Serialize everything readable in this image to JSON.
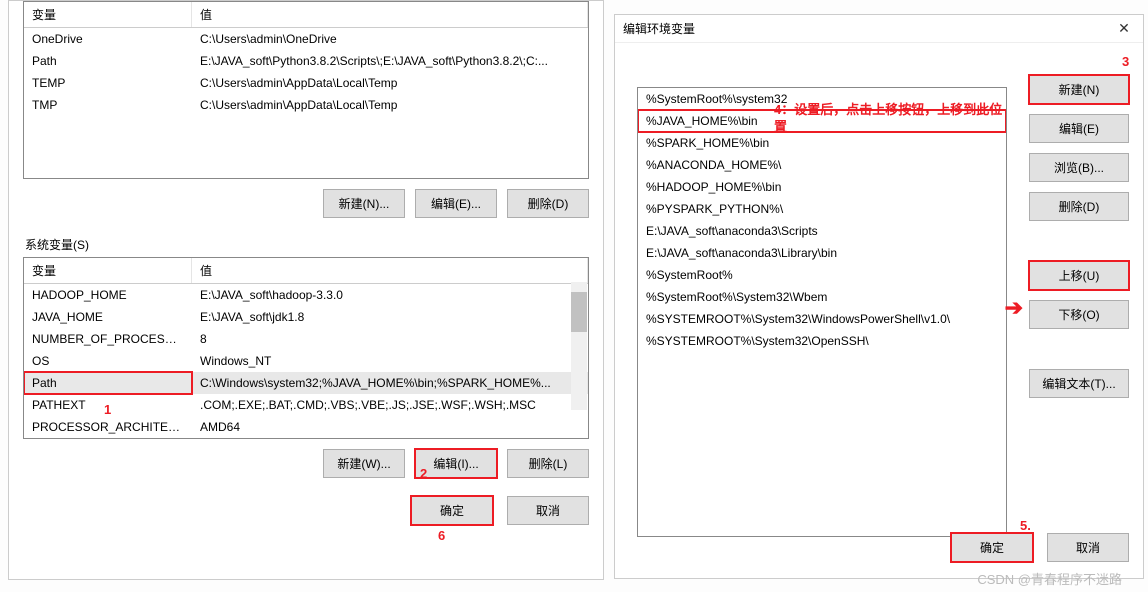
{
  "dialog1": {
    "userVars": {
      "header": {
        "var": "变量",
        "val": "值"
      },
      "rows": [
        {
          "name": "OneDrive",
          "value": "C:\\Users\\admin\\OneDrive"
        },
        {
          "name": "Path",
          "value": "E:\\JAVA_soft\\Python3.8.2\\Scripts\\;E:\\JAVA_soft\\Python3.8.2\\;C:..."
        },
        {
          "name": "TEMP",
          "value": "C:\\Users\\admin\\AppData\\Local\\Temp"
        },
        {
          "name": "TMP",
          "value": "C:\\Users\\admin\\AppData\\Local\\Temp"
        }
      ],
      "buttons": {
        "new": "新建(N)...",
        "edit": "编辑(E)...",
        "delete": "删除(D)"
      }
    },
    "sysLabel": "系统变量(S)",
    "sysVars": {
      "header": {
        "var": "变量",
        "val": "值"
      },
      "rows": [
        {
          "name": "HADOOP_HOME",
          "value": "E:\\JAVA_soft\\hadoop-3.3.0"
        },
        {
          "name": "JAVA_HOME",
          "value": "E:\\JAVA_soft\\jdk1.8"
        },
        {
          "name": "NUMBER_OF_PROCESSORS",
          "value": "8"
        },
        {
          "name": "OS",
          "value": "Windows_NT"
        },
        {
          "name": "Path",
          "value": "C:\\Windows\\system32;%JAVA_HOME%\\bin;%SPARK_HOME%..."
        },
        {
          "name": "PATHEXT",
          "value": ".COM;.EXE;.BAT;.CMD;.VBS;.VBE;.JS;.JSE;.WSF;.WSH;.MSC"
        },
        {
          "name": "PROCESSOR_ARCHITECT...",
          "value": "AMD64"
        }
      ],
      "buttons": {
        "new": "新建(W)...",
        "edit": "编辑(I)...",
        "delete": "删除(L)"
      }
    },
    "footer": {
      "ok": "确定",
      "cancel": "取消"
    }
  },
  "dialog2": {
    "title": "编辑环境变量",
    "pathItems": [
      "%SystemRoot%\\system32",
      "%JAVA_HOME%\\bin",
      "%SPARK_HOME%\\bin",
      "%ANACONDA_HOME%\\",
      "%HADOOP_HOME%\\bin",
      "%PYSPARK_PYTHON%\\",
      "E:\\JAVA_soft\\anaconda3\\Scripts",
      "E:\\JAVA_soft\\anaconda3\\Library\\bin",
      "%SystemRoot%",
      "%SystemRoot%\\System32\\Wbem",
      "%SYSTEMROOT%\\System32\\WindowsPowerShell\\v1.0\\",
      "%SYSTEMROOT%\\System32\\OpenSSH\\"
    ],
    "sideButtons": {
      "new": "新建(N)",
      "edit": "编辑(E)",
      "browse": "浏览(B)...",
      "delete": "删除(D)",
      "moveUp": "上移(U)",
      "moveDown": "下移(O)",
      "editText": "编辑文本(T)..."
    },
    "footer": {
      "ok": "确定",
      "cancel": "取消"
    }
  },
  "annotations": {
    "a1": "1",
    "a2": "2",
    "a3": "3",
    "a4": "4：设置后，点击上移按钮，上移到此位置",
    "a5": "5.",
    "a6": "6"
  },
  "watermark": "CSDN @青春程序不迷路"
}
